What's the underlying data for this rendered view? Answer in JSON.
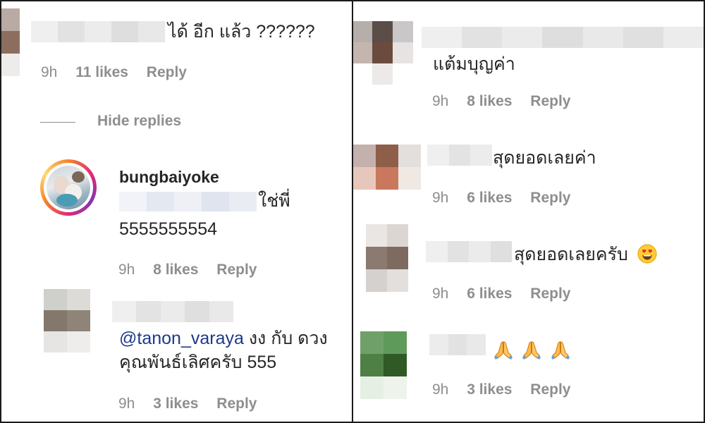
{
  "left": {
    "comment1": {
      "text": "ได้ อีก แล้ว ??????",
      "time": "9h",
      "likes": "11 likes",
      "reply": "Reply"
    },
    "hide_replies": "Hide replies",
    "reply1": {
      "username": "bungbaiyoke",
      "text_suffix": "ใช่พี่",
      "text_line2": "5555555554",
      "time": "9h",
      "likes": "8 likes",
      "reply": "Reply"
    },
    "reply2": {
      "mention": "@tanon_varaya",
      "text_rest": " งง กับ ดวง",
      "text_line2": "คุณพันธ์เลิศครับ 555",
      "time": "9h",
      "likes": "3 likes",
      "reply": "Reply"
    }
  },
  "right": {
    "c1": {
      "text": "แต้มบุญค่า",
      "time": "9h",
      "likes": "8 likes",
      "reply": "Reply"
    },
    "c2": {
      "text": "สุดยอดเลยค่า",
      "time": "9h",
      "likes": "6 likes",
      "reply": "Reply"
    },
    "c3": {
      "text": "สุดยอดเลยครับ",
      "emoji": "heart-eyes-emoji",
      "time": "9h",
      "likes": "6 likes",
      "reply": "Reply"
    },
    "c4": {
      "emoji": "folded-hands-emoji",
      "emoji_count": 3,
      "time": "9h",
      "likes": "3 likes",
      "reply": "Reply"
    }
  }
}
